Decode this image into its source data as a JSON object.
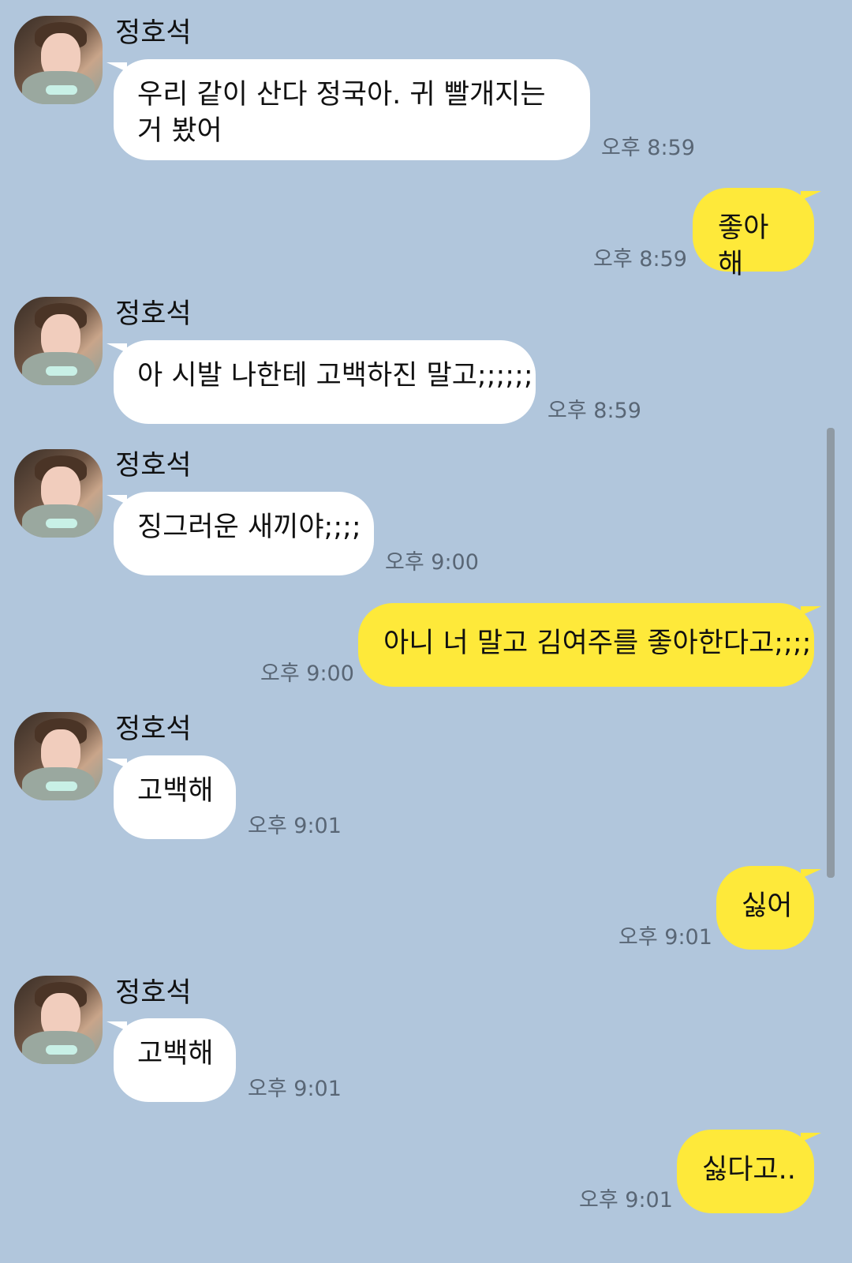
{
  "contact": {
    "name": "정호석"
  },
  "messages": [
    {
      "from": "in",
      "text": "우리 같이 산다 정국아. 귀 빨개지는거 봤어",
      "time": "오후 8:59"
    },
    {
      "from": "out",
      "text": "좋아해",
      "time": "오후 8:59"
    },
    {
      "from": "in",
      "text": "아 시발 나한테 고백하진 말고;;;;;;",
      "time": "오후 8:59"
    },
    {
      "from": "in",
      "text": "징그러운 새끼야;;;;",
      "time": "오후 9:00"
    },
    {
      "from": "out",
      "text": "아니 너 말고 김여주를 좋아한다고;;;;",
      "time": "오후 9:00"
    },
    {
      "from": "in",
      "text": "고백해",
      "time": "오후 9:01"
    },
    {
      "from": "out",
      "text": "싫어",
      "time": "오후 9:01"
    },
    {
      "from": "in",
      "text": "고백해",
      "time": "오후 9:01"
    },
    {
      "from": "out",
      "text": "싫다고..",
      "time": "오후 9:01"
    }
  ],
  "colors": {
    "background": "#b1c6dc",
    "incoming_bubble": "#ffffff",
    "outgoing_bubble": "#fee93a",
    "timestamp": "#596675"
  },
  "icons": {
    "avatar": "profile-photo"
  }
}
